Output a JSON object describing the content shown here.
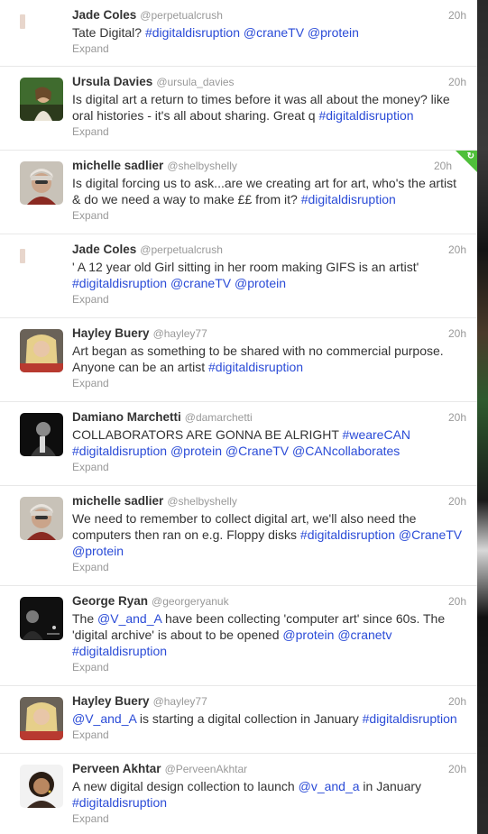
{
  "tweets": [
    {
      "name": "Jade Coles",
      "handle": "@perpetualcrush",
      "time": "20h",
      "parts": [
        {
          "t": "Tate Digital? ",
          "link": false
        },
        {
          "t": "#digitaldisruption",
          "link": true
        },
        {
          "t": " ",
          "link": false
        },
        {
          "t": "@craneTV",
          "link": true
        },
        {
          "t": " ",
          "link": false
        },
        {
          "t": "@protein",
          "link": true
        }
      ],
      "expand": "Expand",
      "avatar": "tiny"
    },
    {
      "name": "Ursula Davies",
      "handle": "@ursula_davies",
      "time": "20h",
      "parts": [
        {
          "t": "Is digital art a return to times before it was all about the money? like oral histories - it's all about sharing. Great q ",
          "link": false
        },
        {
          "t": "#digitaldisruption",
          "link": true
        }
      ],
      "expand": "Expand",
      "avatar": "green"
    },
    {
      "name": "michelle sadlier",
      "handle": "@shelbyshelly",
      "time": "20h",
      "parts": [
        {
          "t": "Is digital forcing us to ask...are we creating art for art, who's the artist & do we need a way to make ££ from it? ",
          "link": false
        },
        {
          "t": "#digitaldisruption",
          "link": true
        }
      ],
      "expand": "Expand",
      "avatar": "grey",
      "corner": true
    },
    {
      "name": "Jade Coles",
      "handle": "@perpetualcrush",
      "time": "20h",
      "parts": [
        {
          "t": "' A 12 year old Girl sitting in her room making GIFS is an artist' ",
          "link": false
        },
        {
          "t": "#digitaldisruption",
          "link": true
        },
        {
          "t": " ",
          "link": false
        },
        {
          "t": "@craneTV",
          "link": true
        },
        {
          "t": " ",
          "link": false
        },
        {
          "t": "@protein",
          "link": true
        }
      ],
      "expand": "Expand",
      "avatar": "tiny"
    },
    {
      "name": "Hayley Buery",
      "handle": "@hayley77",
      "time": "20h",
      "parts": [
        {
          "t": "Art began as something to be shared with no commercial purpose. Anyone can be an artist ",
          "link": false
        },
        {
          "t": "#digitaldisruption",
          "link": true
        }
      ],
      "expand": "Expand",
      "avatar": "blonde"
    },
    {
      "name": "Damiano Marchetti",
      "handle": "@damarchetti",
      "time": "20h",
      "parts": [
        {
          "t": "COLLABORATORS ARE GONNA BE ALRIGHT ",
          "link": false
        },
        {
          "t": "#weareCAN",
          "link": true
        },
        {
          "t": " ",
          "link": false
        },
        {
          "t": "#digitaldisruption",
          "link": true
        },
        {
          "t": " ",
          "link": false
        },
        {
          "t": "@protein",
          "link": true
        },
        {
          "t": " ",
          "link": false
        },
        {
          "t": "@CraneTV",
          "link": true
        },
        {
          "t": " ",
          "link": false
        },
        {
          "t": "@CANcollaborates",
          "link": true
        }
      ],
      "expand": "Expand",
      "avatar": "dark"
    },
    {
      "name": "michelle sadlier",
      "handle": "@shelbyshelly",
      "time": "20h",
      "parts": [
        {
          "t": "We need to remember to collect digital art, we'll also need the computers then ran on e.g. Floppy disks ",
          "link": false
        },
        {
          "t": "#digitaldisruption",
          "link": true
        },
        {
          "t": " ",
          "link": false
        },
        {
          "t": "@CraneTV",
          "link": true
        },
        {
          "t": " ",
          "link": false
        },
        {
          "t": "@protein",
          "link": true
        }
      ],
      "expand": "Expand",
      "avatar": "grey"
    },
    {
      "name": "George Ryan",
      "handle": "@georgeryanuk",
      "time": "20h",
      "parts": [
        {
          "t": "The ",
          "link": false
        },
        {
          "t": "@V_and_A",
          "link": true
        },
        {
          "t": " have been collecting 'computer art' since 60s. The 'digital archive' is about to be opened ",
          "link": false
        },
        {
          "t": "@protein",
          "link": true
        },
        {
          "t": " ",
          "link": false
        },
        {
          "t": "@cranetv",
          "link": true
        },
        {
          "t": " ",
          "link": false
        },
        {
          "t": "#digitaldisruption",
          "link": true
        }
      ],
      "expand": "Expand",
      "avatar": "night"
    },
    {
      "name": "Hayley Buery",
      "handle": "@hayley77",
      "time": "20h",
      "parts": [
        {
          "t": "@V_and_A",
          "link": true
        },
        {
          "t": " is starting a digital collection in January ",
          "link": false
        },
        {
          "t": "#digitaldisruption",
          "link": true
        }
      ],
      "expand": "Expand",
      "avatar": "blonde"
    },
    {
      "name": "Perveen Akhtar",
      "handle": "@PerveenAkhtar",
      "time": "20h",
      "parts": [
        {
          "t": "A new digital design collection to launch ",
          "link": false
        },
        {
          "t": "@v_and_a",
          "link": true
        },
        {
          "t": " in January ",
          "link": false
        },
        {
          "t": "#digitaldisruption",
          "link": true
        }
      ],
      "expand": "Expand",
      "avatar": "portrait"
    }
  ],
  "colors": {
    "link": "#2a4bd7",
    "name": "#333333",
    "meta": "#999999",
    "corner": "#4fbf3a"
  }
}
